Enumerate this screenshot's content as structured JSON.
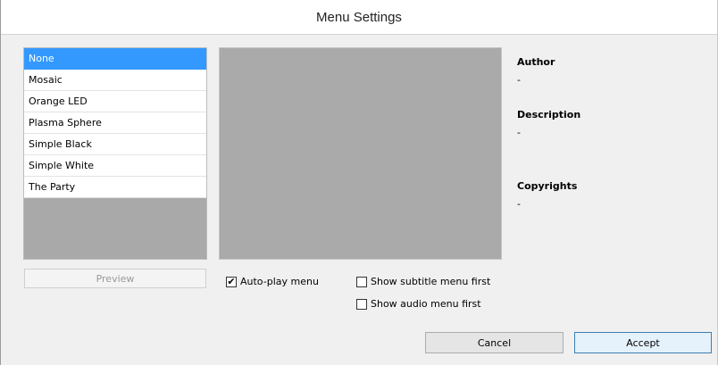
{
  "window": {
    "title": "Menu Settings"
  },
  "menu_list": {
    "items": [
      "None",
      "Mosaic",
      "Orange LED",
      "Plasma Sphere",
      "Simple Black",
      "Simple White",
      "The Party"
    ],
    "selected": "None"
  },
  "info": {
    "author_label": "Author",
    "author_value": "-",
    "description_label": "Description",
    "description_value": "-",
    "copyrights_label": "Copyrights",
    "copyrights_value": "-"
  },
  "buttons": {
    "preview": "Preview",
    "cancel": "Cancel",
    "accept": "Accept"
  },
  "options": {
    "autoplay_label": "Auto-play menu",
    "autoplay_checked": true,
    "subtitle_first_label": "Show subtitle menu first",
    "subtitle_first_checked": false,
    "audio_first_label": "Show audio menu first",
    "audio_first_checked": false
  },
  "colors": {
    "selection": "#3399ff",
    "preview_bg": "#aaaaaa"
  }
}
